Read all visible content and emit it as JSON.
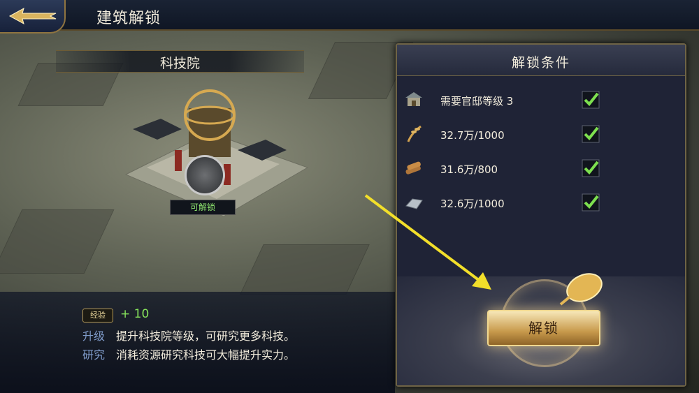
{
  "header": {
    "title": "建筑解锁",
    "back_icon": "back-arrow-icon"
  },
  "building": {
    "name": "科技院",
    "status_badge": "可解锁"
  },
  "info": {
    "exp_chip": "经验",
    "exp_value": "+ 10",
    "rows": [
      {
        "label": "升级",
        "text": "提升科技院等级，可研究更多科技。"
      },
      {
        "label": "研究",
        "text": "消耗资源研究科技可大幅提升实力。"
      }
    ]
  },
  "conditions": {
    "title": "解锁条件",
    "items": [
      {
        "icon": "mansion-icon",
        "text": "需要官邸等级 3",
        "met": true
      },
      {
        "icon": "grain-icon",
        "text": "32.7万/1000",
        "met": true
      },
      {
        "icon": "wood-icon",
        "text": "31.6万/800",
        "met": true
      },
      {
        "icon": "iron-icon",
        "text": "32.6万/1000",
        "met": true
      }
    ],
    "unlock_button": "解锁"
  },
  "colors": {
    "accent_gold": "#c89a4c",
    "check_green": "#7de04f",
    "panel_bg": "#1f2336"
  }
}
